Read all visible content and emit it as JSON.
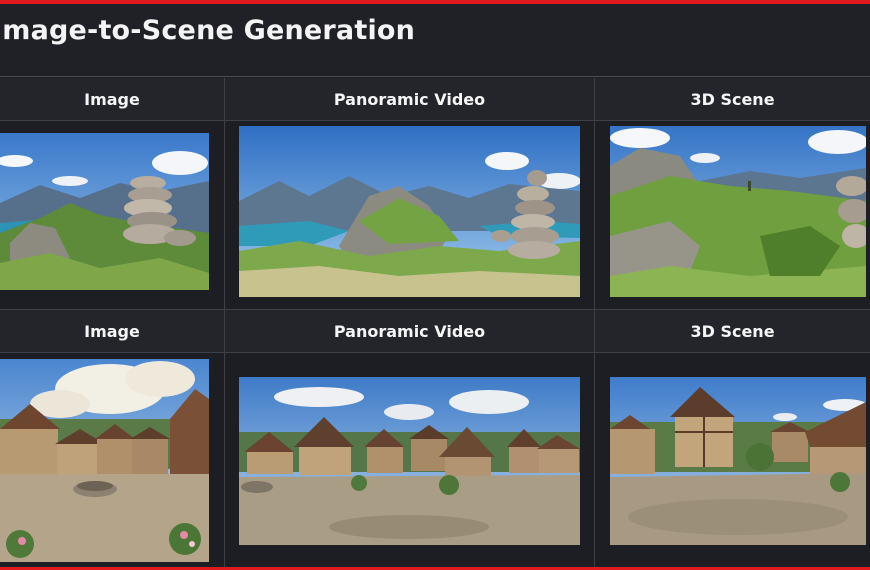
{
  "page": {
    "title": "Image-to-Scene Generation"
  },
  "columns": [
    "Image",
    "Panoramic Video",
    "3D Scene"
  ],
  "rows": [
    {
      "headers": [
        "Image",
        "Panoramic Video",
        "3D Scene"
      ],
      "thumbnails": [
        "mountain-lake-cairn-image",
        "mountain-lake-cairn-panorama",
        "mountain-cairn-3d-scene"
      ]
    },
    {
      "headers": [
        "Image",
        "Panoramic Video",
        "3D Scene"
      ],
      "thumbnails": [
        "village-square-image",
        "village-square-panorama",
        "village-square-3d-scene"
      ]
    }
  ],
  "colors": {
    "accent_border": "#e0191f",
    "background": "#1f2127",
    "grid_line": "#3c3f47"
  }
}
